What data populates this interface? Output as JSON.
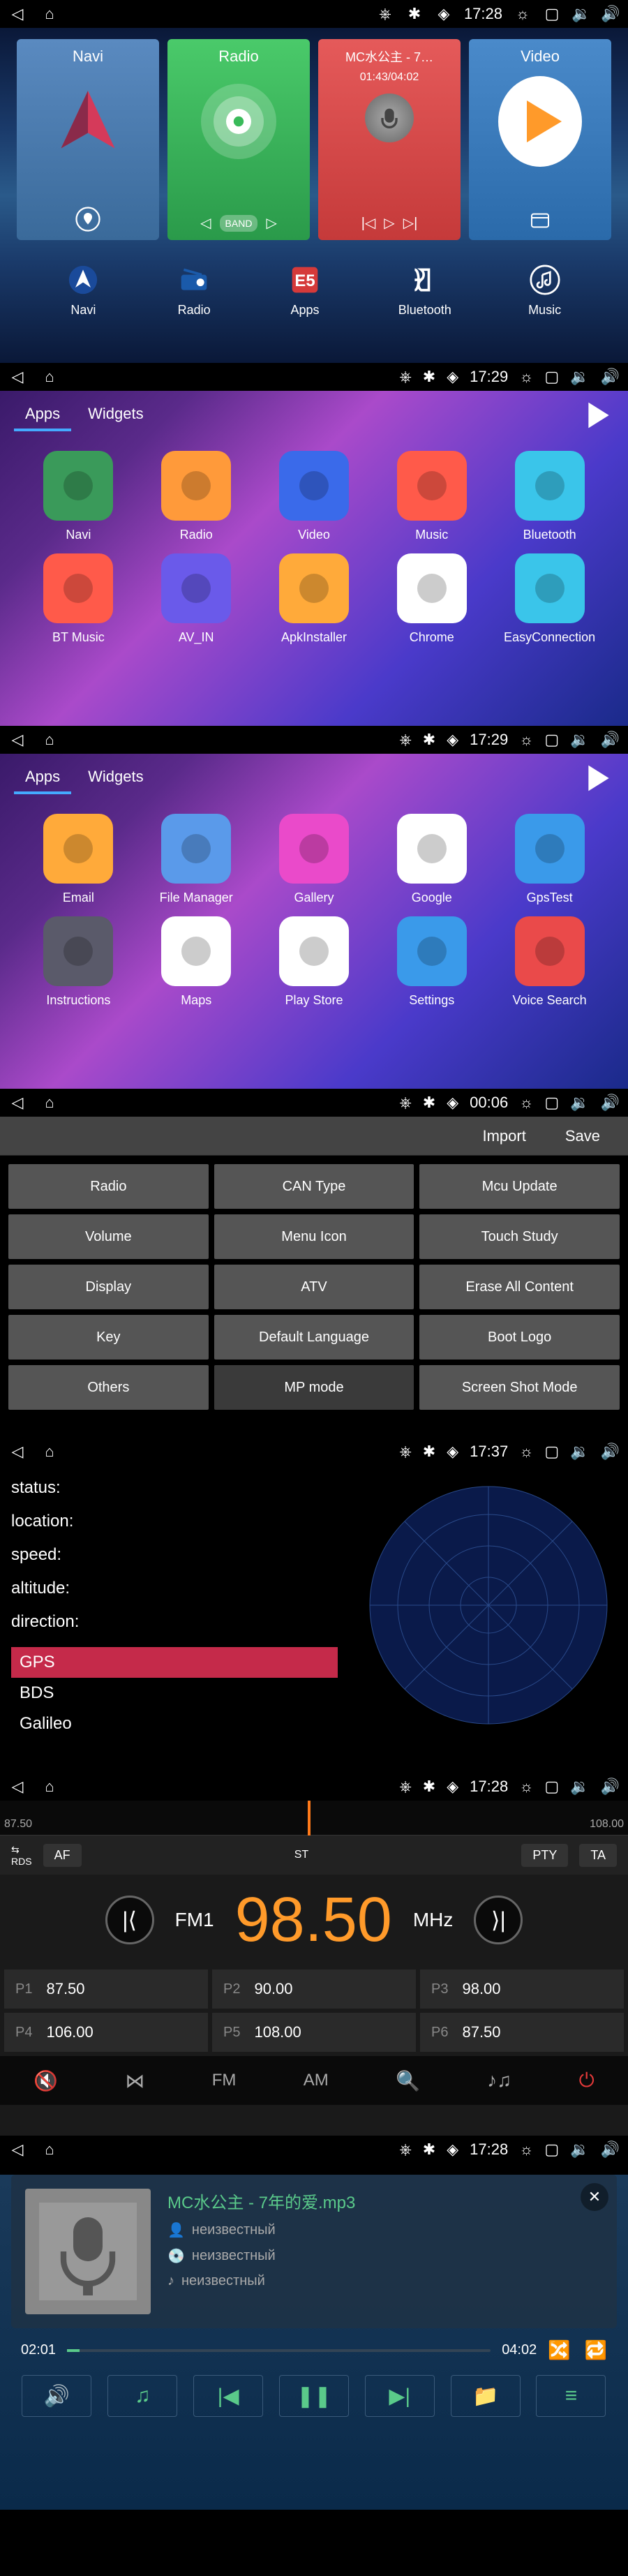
{
  "statusbar": {
    "times": {
      "s1": "17:28",
      "s2": "17:29",
      "s3": "17:29",
      "s4": "00:06",
      "s5": "17:37",
      "s6": "17:28",
      "s7": "17:28"
    }
  },
  "home": {
    "cards": {
      "navi": {
        "title": "Navi"
      },
      "radio": {
        "title": "Radio",
        "band": "BAND"
      },
      "music": {
        "title": "MC水公主 - 7…",
        "time": "01:43/04:02"
      },
      "video": {
        "title": "Video"
      }
    },
    "dock": [
      {
        "label": "Navi"
      },
      {
        "label": "Radio"
      },
      {
        "label": "Apps"
      },
      {
        "label": "Bluetooth"
      },
      {
        "label": "Music"
      }
    ]
  },
  "drawer": {
    "tabs": {
      "apps": "Apps",
      "widgets": "Widgets"
    },
    "page1": [
      {
        "label": "Navi",
        "color": "#3a9a5a"
      },
      {
        "label": "Radio",
        "color": "#ff9a3a"
      },
      {
        "label": "Video",
        "color": "#3a6aea"
      },
      {
        "label": "Music",
        "color": "#ff5a4a"
      },
      {
        "label": "Bluetooth",
        "color": "#3ac5ea"
      },
      {
        "label": "BT Music",
        "color": "#ff5a4a"
      },
      {
        "label": "AV_IN",
        "color": "#6a5aea"
      },
      {
        "label": "ApkInstaller",
        "color": "#ffaa3a"
      },
      {
        "label": "Chrome",
        "color": "#fff"
      },
      {
        "label": "EasyConnection",
        "color": "#3ac5ea"
      }
    ],
    "page2": [
      {
        "label": "Email",
        "color": "#ffaa3a"
      },
      {
        "label": "File Manager",
        "color": "#5a9aea"
      },
      {
        "label": "Gallery",
        "color": "#ea4aca"
      },
      {
        "label": "Google",
        "color": "#fff"
      },
      {
        "label": "GpsTest",
        "color": "#3a9aea"
      },
      {
        "label": "Instructions",
        "color": "#5a5a6a"
      },
      {
        "label": "Maps",
        "color": "#fff"
      },
      {
        "label": "Play Store",
        "color": "#fff"
      },
      {
        "label": "Settings",
        "color": "#3a9aea"
      },
      {
        "label": "Voice Search",
        "color": "#ea4a4a"
      }
    ]
  },
  "settings": {
    "import": "Import",
    "save": "Save",
    "cells": [
      "Radio",
      "CAN Type",
      "Mcu Update",
      "Volume",
      "Menu Icon",
      "Touch Study",
      "Display",
      "ATV",
      "Erase All Content",
      "Key",
      "Default Language",
      "Boot Logo",
      "Others",
      "MP mode",
      "Screen Shot Mode"
    ],
    "active_index": 13
  },
  "gps": {
    "rows": {
      "status": "status:",
      "location": "location:",
      "speed": "speed:",
      "altitude": "altitude:",
      "direction": "direction:"
    },
    "systems": [
      {
        "name": "GPS",
        "active": true
      },
      {
        "name": "BDS",
        "active": false
      },
      {
        "name": "Galileo",
        "active": false
      }
    ]
  },
  "radio": {
    "scale": {
      "left": "87.50",
      "right": "108.00"
    },
    "toolbar": {
      "af": "AF",
      "st": "ST",
      "pty": "PTY",
      "ta": "TA"
    },
    "band": "FM1",
    "freq": "98.50",
    "unit": "MHz",
    "presets": [
      {
        "slot": "P1",
        "freq": "87.50"
      },
      {
        "slot": "P2",
        "freq": "90.00"
      },
      {
        "slot": "P3",
        "freq": "98.00"
      },
      {
        "slot": "P4",
        "freq": "106.00"
      },
      {
        "slot": "P5",
        "freq": "108.00"
      },
      {
        "slot": "P6",
        "freq": "87.50"
      }
    ],
    "bottom": {
      "fm": "FM",
      "am": "AM"
    }
  },
  "music": {
    "title": "MC水公主 - 7年的爱.mp3",
    "artist": "неизвестный",
    "album": "неизвестный",
    "genre": "неизвестный",
    "elapsed": "02:01",
    "total": "04:02"
  }
}
